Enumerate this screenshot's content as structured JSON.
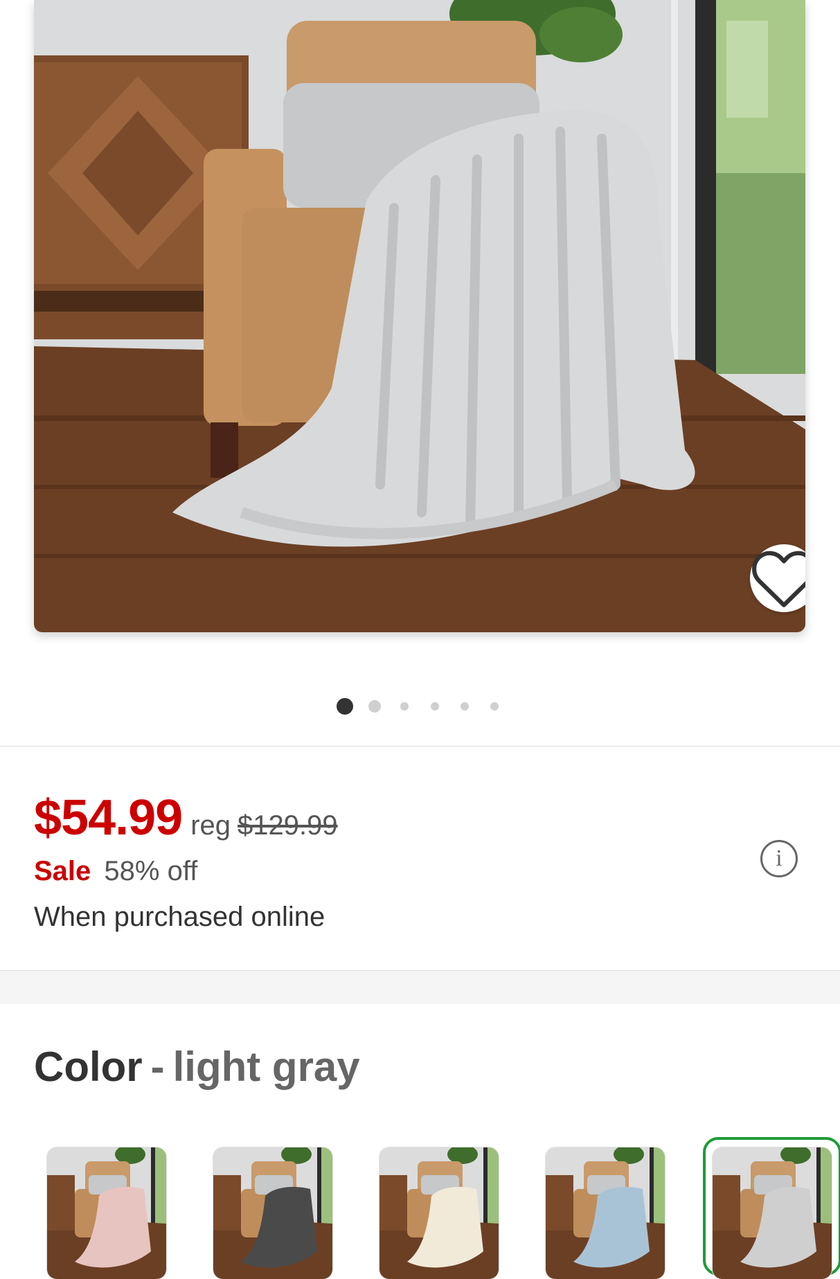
{
  "product_image": {
    "icon": "product-photo-chunky-knit-throw",
    "favorite_icon": "heart-outline-icon"
  },
  "carousel": {
    "total": 6,
    "active": 0
  },
  "price": {
    "sale_price": "$54.99",
    "reg_label": "reg",
    "reg_price": "$129.99",
    "sale_label": "Sale",
    "discount": "58% off",
    "note": "When purchased online",
    "info_icon": "info-icon"
  },
  "color": {
    "label": "Color",
    "separator": "-",
    "selected": "light gray",
    "swatches": [
      {
        "blanket_color": "#e8c4c0",
        "selected": false
      },
      {
        "blanket_color": "#4a4a4a",
        "selected": false
      },
      {
        "blanket_color": "#f2ead9",
        "selected": false
      },
      {
        "blanket_color": "#a9c3d6",
        "selected": false
      },
      {
        "blanket_color": "#cfcfcf",
        "selected": true
      }
    ]
  },
  "colors": {
    "sale_red": "#cc0000",
    "selected_ring": "#1f9b3a",
    "text_dark": "#333333",
    "text_muted": "#555555"
  }
}
